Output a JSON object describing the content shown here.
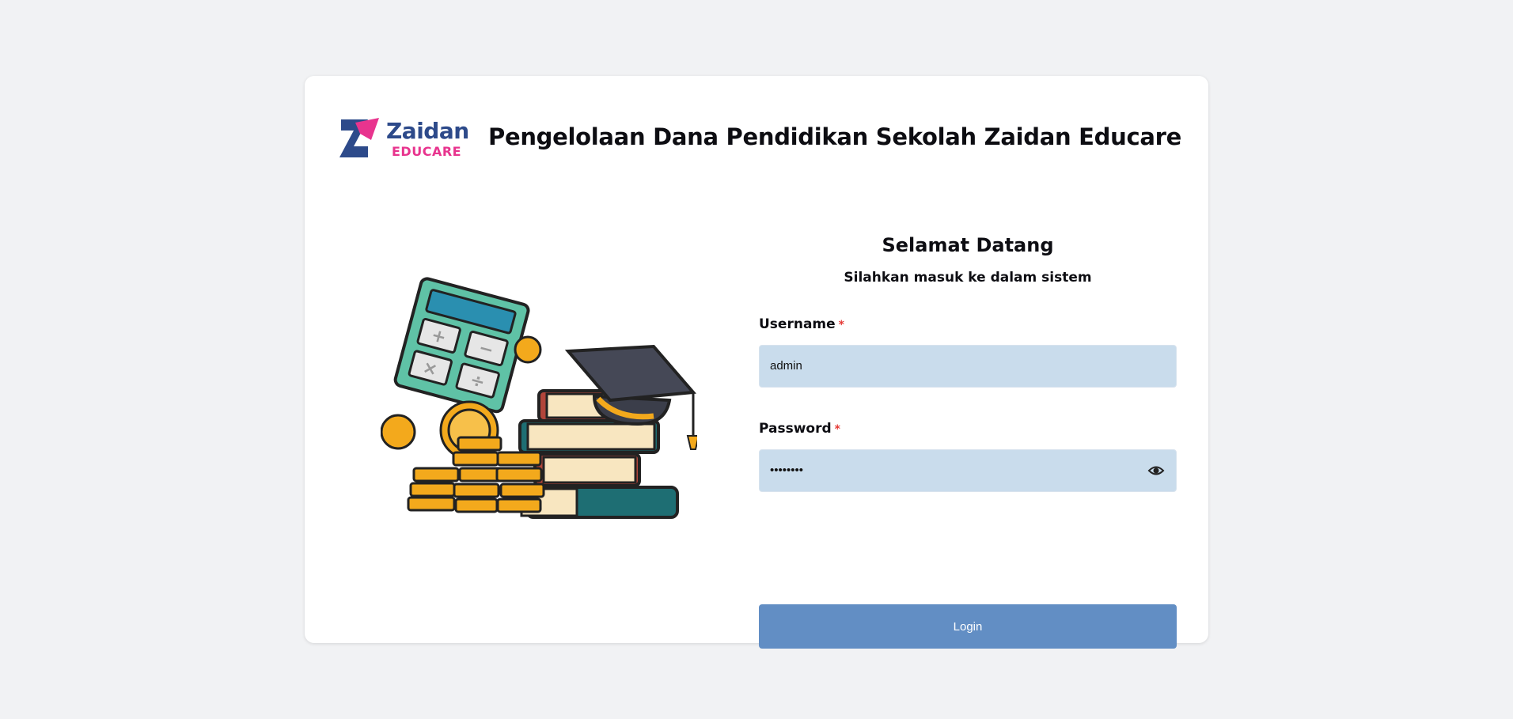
{
  "brand": {
    "name": "Zaidan",
    "sub": "EDUCARE",
    "primary_color": "#2d4a8a",
    "accent_color": "#e8348e"
  },
  "header": {
    "title": "Pengelolaan Dana Pendidikan Sekolah Zaidan Educare"
  },
  "login": {
    "welcome": "Selamat Datang",
    "subtitle": "Silahkan masuk ke dalam sistem",
    "username_label": "Username",
    "username_value": "admin",
    "password_label": "Password",
    "password_value": "••••••••",
    "required_marker": "*",
    "password_toggle_icon": "eye-icon",
    "login_label": "Login",
    "button_color": "#628ec4",
    "input_bg": "#c9dcec"
  }
}
